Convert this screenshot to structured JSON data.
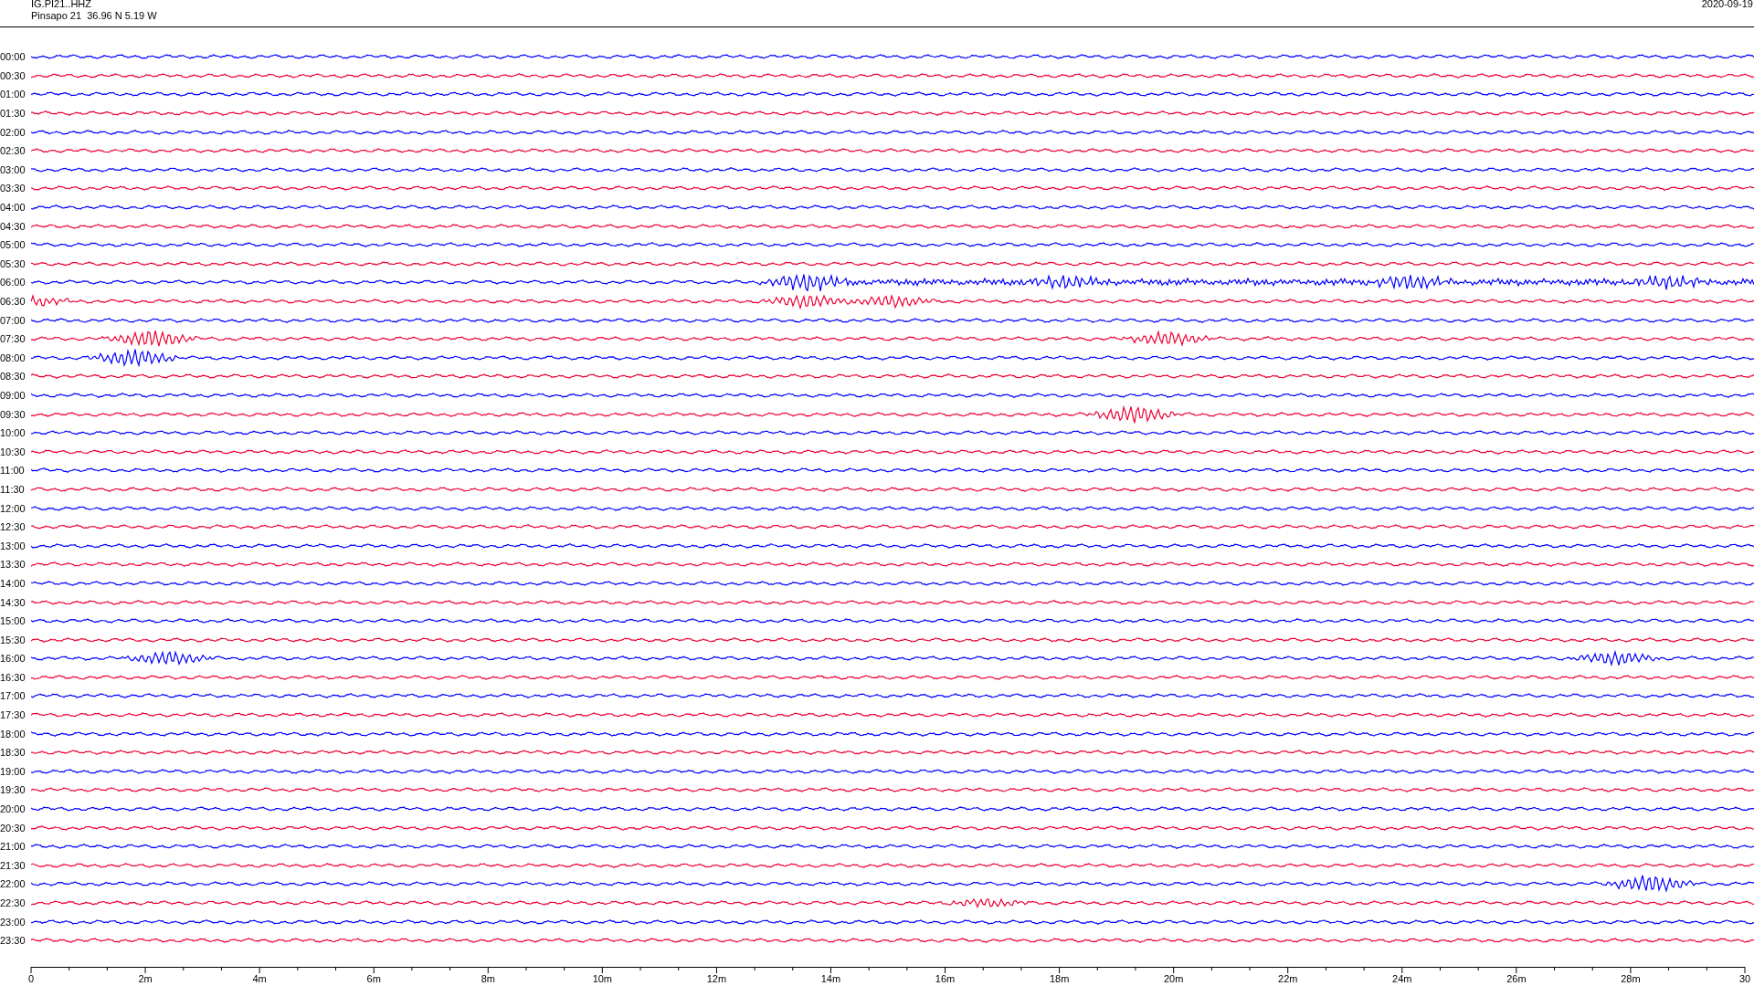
{
  "header": {
    "channel": "IG.PI21..HHZ",
    "station": "Pinsapo 21  36.96 N 5.19 W",
    "date": "2020-09-19"
  },
  "rows": [
    {
      "label": "00:00",
      "color": "#0000ff"
    },
    {
      "label": "00:30",
      "color": "#ee0033"
    },
    {
      "label": "01:00",
      "color": "#0000ff"
    },
    {
      "label": "01:30",
      "color": "#ee0033"
    },
    {
      "label": "02:00",
      "color": "#0000ff"
    },
    {
      "label": "02:30",
      "color": "#ee0033"
    },
    {
      "label": "03:00",
      "color": "#0000ff"
    },
    {
      "label": "03:30",
      "color": "#ee0033"
    },
    {
      "label": "04:00",
      "color": "#0000ff"
    },
    {
      "label": "04:30",
      "color": "#ee0033"
    },
    {
      "label": "05:00",
      "color": "#0000ff"
    },
    {
      "label": "05:30",
      "color": "#ee0033"
    },
    {
      "label": "06:00",
      "color": "#0000ff"
    },
    {
      "label": "06:30",
      "color": "#ee0033"
    },
    {
      "label": "07:00",
      "color": "#0000ff"
    },
    {
      "label": "07:30",
      "color": "#ee0033"
    },
    {
      "label": "08:00",
      "color": "#0000ff"
    },
    {
      "label": "08:30",
      "color": "#ee0033"
    },
    {
      "label": "09:00",
      "color": "#0000ff"
    },
    {
      "label": "09:30",
      "color": "#ee0033"
    },
    {
      "label": "10:00",
      "color": "#0000ff"
    },
    {
      "label": "10:30",
      "color": "#ee0033"
    },
    {
      "label": "11:00",
      "color": "#0000ff"
    },
    {
      "label": "11:30",
      "color": "#ee0033"
    },
    {
      "label": "12:00",
      "color": "#0000ff"
    },
    {
      "label": "12:30",
      "color": "#ee0033"
    },
    {
      "label": "13:00",
      "color": "#0000ff"
    },
    {
      "label": "13:30",
      "color": "#ee0033"
    },
    {
      "label": "14:00",
      "color": "#0000ff"
    },
    {
      "label": "14:30",
      "color": "#ee0033"
    },
    {
      "label": "15:00",
      "color": "#0000ff"
    },
    {
      "label": "15:30",
      "color": "#ee0033"
    },
    {
      "label": "16:00",
      "color": "#0000ff"
    },
    {
      "label": "16:30",
      "color": "#ee0033"
    },
    {
      "label": "17:00",
      "color": "#0000ff"
    },
    {
      "label": "17:30",
      "color": "#ee0033"
    },
    {
      "label": "18:00",
      "color": "#0000ff"
    },
    {
      "label": "18:30",
      "color": "#ee0033"
    },
    {
      "label": "19:00",
      "color": "#0000ff"
    },
    {
      "label": "19:30",
      "color": "#ee0033"
    },
    {
      "label": "20:00",
      "color": "#0000ff"
    },
    {
      "label": "20:30",
      "color": "#ee0033"
    },
    {
      "label": "21:00",
      "color": "#0000ff"
    },
    {
      "label": "21:30",
      "color": "#ee0033"
    },
    {
      "label": "22:00",
      "color": "#0000ff"
    },
    {
      "label": "22:30",
      "color": "#ee0033"
    },
    {
      "label": "23:00",
      "color": "#0000ff"
    },
    {
      "label": "23:30",
      "color": "#ee0033"
    }
  ],
  "x_axis": [
    "0",
    "2m",
    "4m",
    "6m",
    "8m",
    "10m",
    "12m",
    "14m",
    "16m",
    "18m",
    "20m",
    "22m",
    "24m",
    "26m",
    "28m",
    "30"
  ]
}
